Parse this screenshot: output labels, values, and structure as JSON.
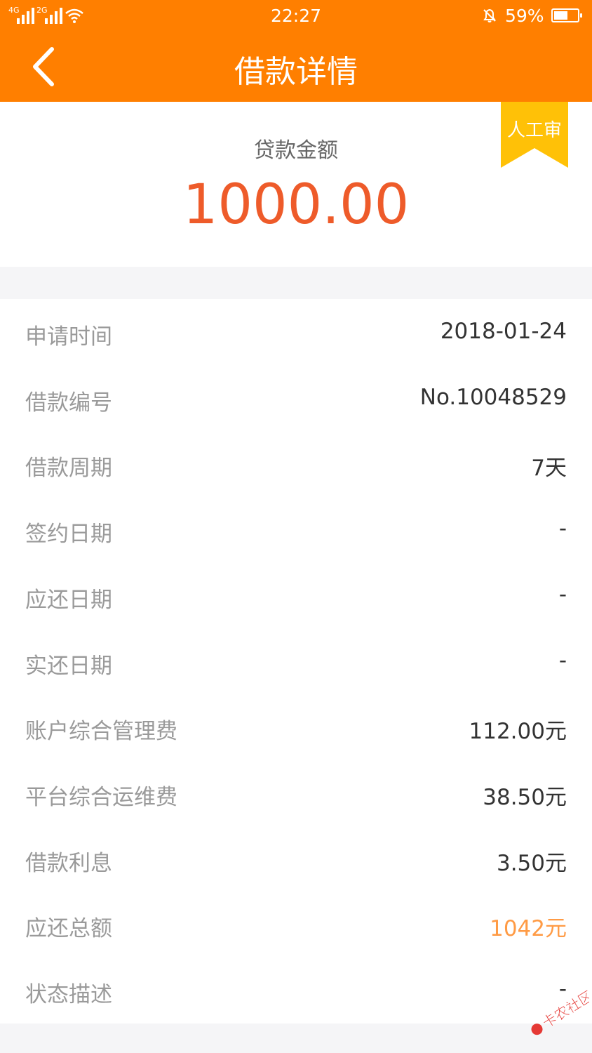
{
  "status_bar": {
    "network_1": "4G",
    "network_2": "2G",
    "time": "22:27",
    "battery": "59%",
    "battery_level_percent": 59
  },
  "header": {
    "title": "借款详情",
    "back_icon": "chevron-left-icon"
  },
  "summary": {
    "amount_label": "贷款金额",
    "amount": "1000.00",
    "ribbon_label": "人工审",
    "amount_color": "#ee5b2a",
    "ribbon_color": "#ffc107"
  },
  "details": [
    {
      "label": "申请时间",
      "value": "2018-01-24"
    },
    {
      "label": "借款编号",
      "value": "No.10048529"
    },
    {
      "label": "借款周期",
      "value": "7天"
    },
    {
      "label": "签约日期",
      "value": "-"
    },
    {
      "label": "应还日期",
      "value": "-"
    },
    {
      "label": "实还日期",
      "value": "-"
    },
    {
      "label": "账户综合管理费",
      "value": "112.00元"
    },
    {
      "label": "平台综合运维费",
      "value": "38.50元"
    },
    {
      "label": "借款利息",
      "value": "3.50元"
    },
    {
      "label": "应还总额",
      "value": "1042元"
    },
    {
      "label": "状态描述",
      "value": "-"
    }
  ],
  "watermark": {
    "text": "卡农社区"
  },
  "colors": {
    "primary": "#ff7f00",
    "accent_value": "#ff9b45",
    "background": "#f5f5f7"
  }
}
